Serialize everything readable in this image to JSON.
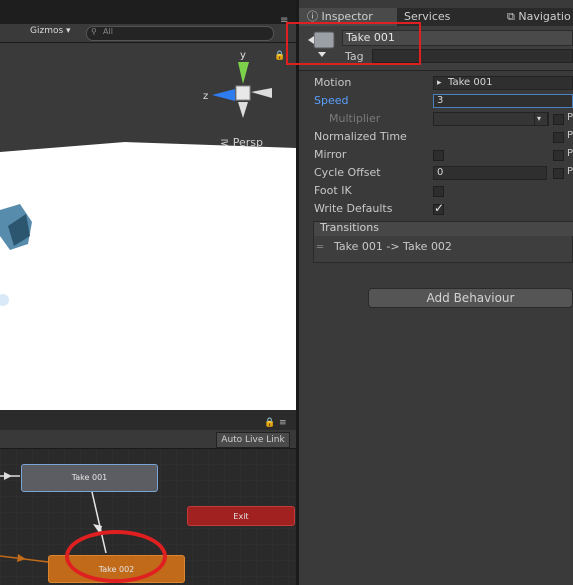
{
  "scene": {
    "gizmos_label": "Gizmos ▾",
    "search_placeholder": "All",
    "persp_label": "Persp",
    "axis_y": "y",
    "axis_z": "z"
  },
  "animator": {
    "auto_live_link": "Auto Live Link",
    "nodes": {
      "take001": "Take 001",
      "exit": "Exit",
      "take002": "Take 002"
    }
  },
  "inspector": {
    "tabs": {
      "inspector": "Inspector",
      "services": "Services",
      "navigation": "Navigatio"
    },
    "state_name": "Take 001",
    "tag_label": "Tag",
    "properties": {
      "motion_label": "Motion",
      "motion_value": "Take 001",
      "speed_label": "Speed",
      "speed_value": "3",
      "multiplier_label": "Multiplier",
      "normalized_time_label": "Normalized Time",
      "mirror_label": "Mirror",
      "cycle_offset_label": "Cycle Offset",
      "cycle_offset_value": "0",
      "foot_ik_label": "Foot IK",
      "write_defaults_label": "Write Defaults"
    },
    "param_letter": "P",
    "transitions_title": "Transitions",
    "transition_item": "Take 001 -> Take 002",
    "add_behaviour": "Add Behaviour"
  },
  "colors": {
    "accent_highlight": "#e02020",
    "speed_label_blue": "#5aa0ff",
    "node_default": "#5b5d62",
    "node_exit": "#a12020",
    "node_entry_state": "#c06a1a"
  }
}
